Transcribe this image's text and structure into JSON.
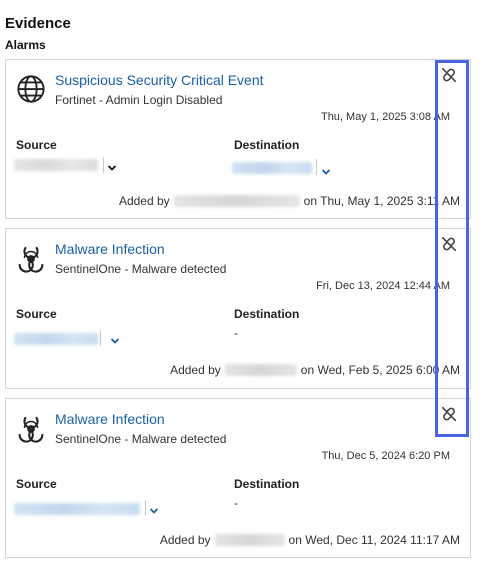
{
  "section": {
    "title": "Evidence",
    "subtitle": "Alarms"
  },
  "labels": {
    "source": "Source",
    "destination": "Destination",
    "added_by": "Added by",
    "empty": "-"
  },
  "colors": {
    "link": "#1a5fa6",
    "highlight": "#4a63e0",
    "border": "#d4d4d4"
  },
  "alarms": [
    {
      "icon": "globe-icon",
      "title": "Suspicious Security Critical Event",
      "description": "Fortinet - Admin Login Disabled",
      "date": "Thu, May 1, 2025 3:08 AM",
      "added_on": "on Thu, May 1, 2025 3:11 AM"
    },
    {
      "icon": "biohazard-icon",
      "title": "Malware Infection",
      "description": "SentinelOne - Malware detected",
      "date": "Fri, Dec 13, 2024 12:44 AM",
      "added_on": "on Wed, Feb 5, 2025 6:00 AM"
    },
    {
      "icon": "biohazard-icon",
      "title": "Malware Infection",
      "description": "SentinelOne - Malware detected",
      "date": "Thu, Dec 5, 2024 6:20 PM",
      "added_on": "on Wed, Dec 11, 2024 11:17 AM"
    }
  ]
}
